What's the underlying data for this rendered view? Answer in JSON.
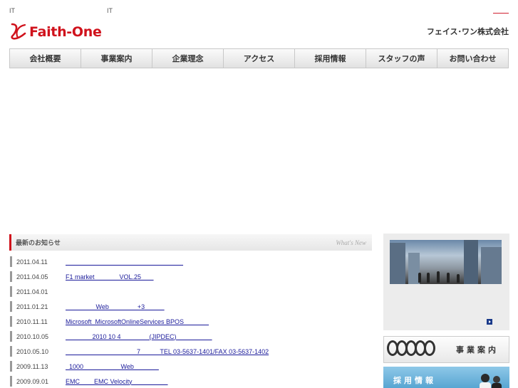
{
  "header": {
    "top_left_text_1": "IT",
    "top_left_text_2": "IT",
    "logo_text": "Faith-One",
    "company_name": "フェイス･ワン株式会社"
  },
  "nav": {
    "items": [
      {
        "label": "会社概要"
      },
      {
        "label": "事業案内"
      },
      {
        "label": "企業理念"
      },
      {
        "label": "アクセス"
      },
      {
        "label": "採用情報"
      },
      {
        "label": "スタッフの声"
      },
      {
        "label": "お問い合わせ"
      }
    ]
  },
  "news": {
    "title": "最新のお知らせ",
    "title_en": "What's New",
    "items": [
      {
        "date": "2011.04.11",
        "text": "                                                                  "
      },
      {
        "date": "2011.04.05",
        "text": "F1 market              VOL.25       "
      },
      {
        "date": "2011.04.01",
        "text": ""
      },
      {
        "date": "2011.01.21",
        "text": "                 Web                +3           "
      },
      {
        "date": "2010.11.11",
        "text": "Microsoft  MicrosoftOnlineServices BPOS              "
      },
      {
        "date": "2010.10.05",
        "text": "               2010 10 4                (JIPDEC)                    "
      },
      {
        "date": "2010.05.10",
        "text": "                                        7           TEL 03-5637-1401/FAX 03-5637-1402"
      },
      {
        "date": "2009.11.13",
        "text": "  1000                     Web              "
      },
      {
        "date": "2009.09.01",
        "text": "EMC        EMC Velocity                    "
      }
    ]
  },
  "side": {
    "business_label": "事業案内",
    "recruit_label": "採用情報"
  },
  "colors": {
    "brand_red": "#d0121c",
    "link_blue": "#1a1a9a"
  }
}
